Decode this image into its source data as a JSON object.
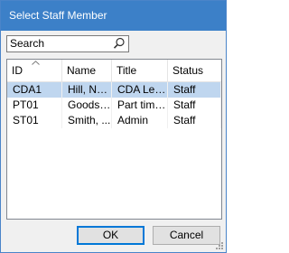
{
  "window": {
    "title": "Select Staff Member"
  },
  "search": {
    "placeholder": "Search",
    "value": ""
  },
  "table": {
    "columns": [
      {
        "key": "id",
        "label": "ID",
        "sorted": "ascending"
      },
      {
        "key": "name",
        "label": "Name"
      },
      {
        "key": "title",
        "label": "Title"
      },
      {
        "key": "status",
        "label": "Status"
      }
    ],
    "rows": [
      {
        "id": "CDA1",
        "name": "Hill, Na...",
        "title": "CDA Lev...",
        "status": "Staff",
        "selected": true
      },
      {
        "id": "PT01",
        "name": "Goodst...",
        "title": "Part time ...",
        "status": "Staff",
        "selected": false
      },
      {
        "id": "ST01",
        "name": "Smith, ...",
        "title": "Admin",
        "status": "Staff",
        "selected": false
      }
    ]
  },
  "buttons": {
    "ok": "OK",
    "cancel": "Cancel"
  },
  "colors": {
    "titlebar": "#3c80c8",
    "selected_row": "#bfd6ef",
    "default_button_border": "#0078d7"
  },
  "icons": {
    "search": "magnifier-icon",
    "sort": "sort-ascending-icon",
    "resize": "size-grip-icon"
  }
}
